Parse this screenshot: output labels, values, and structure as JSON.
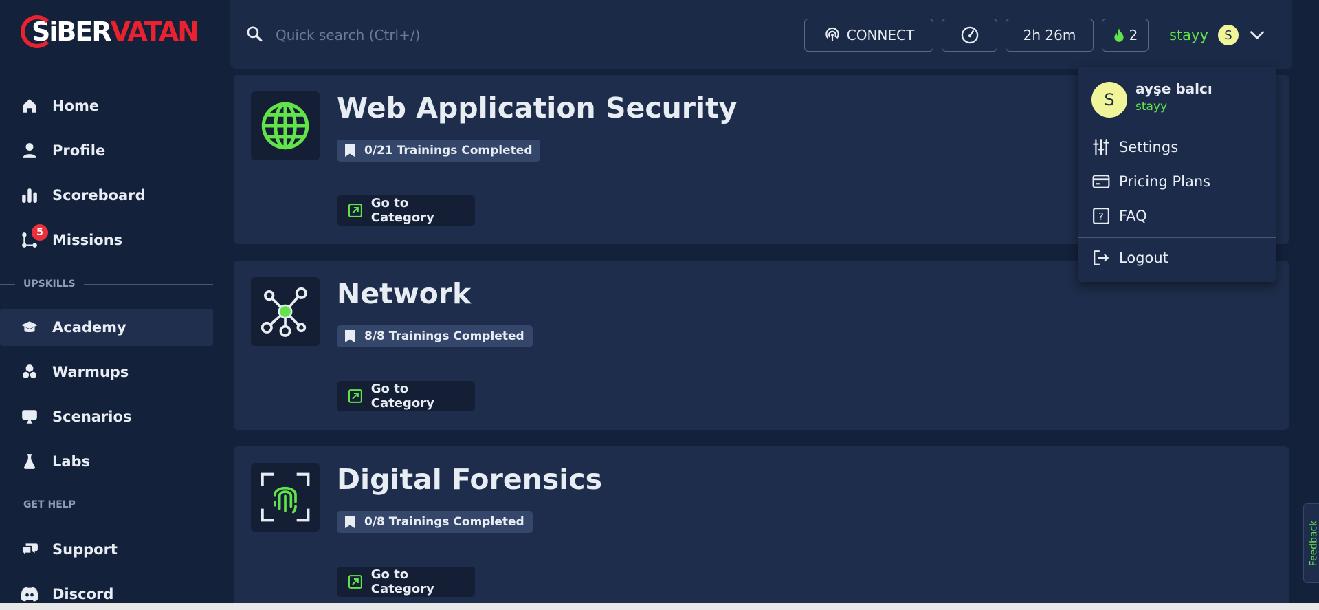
{
  "brand": {
    "logo_left": "Si",
    "logo_mid": "BER",
    "logo_right": "VATAN"
  },
  "sidebar": {
    "items": [
      {
        "label": "Home",
        "icon": "home-icon"
      },
      {
        "label": "Profile",
        "icon": "user-icon"
      },
      {
        "label": "Scoreboard",
        "icon": "bar-chart-icon"
      },
      {
        "label": "Missions",
        "icon": "missions-icon",
        "badge": "5"
      }
    ],
    "section_upskills": "UPSKILLS",
    "upskills": [
      {
        "label": "Academy",
        "icon": "graduation-cap-icon",
        "active": true
      },
      {
        "label": "Warmups",
        "icon": "warmups-icon"
      },
      {
        "label": "Scenarios",
        "icon": "scenarios-icon"
      },
      {
        "label": "Labs",
        "icon": "flask-icon"
      }
    ],
    "section_help": "GET HELP",
    "help": [
      {
        "label": "Support",
        "icon": "chat-bubbles-icon"
      },
      {
        "label": "Discord",
        "icon": "discord-icon"
      }
    ]
  },
  "topbar": {
    "search_placeholder": "Quick search (Ctrl+/)",
    "connect_label": "CONNECT",
    "timer": "2h 26m",
    "streak_count": "2",
    "username": "stayy",
    "avatar_letter": "S"
  },
  "categories": [
    {
      "title": "Web Application Security",
      "progress": "0/21 Trainings Completed",
      "button": "Go to Category",
      "icon": "globe-icon"
    },
    {
      "title": "Network",
      "progress": "8/8 Trainings Completed",
      "button": "Go to Category",
      "icon": "network-icon"
    },
    {
      "title": "Digital Forensics",
      "progress": "0/8 Trainings Completed",
      "button": "Go to Category",
      "icon": "fingerprint-icon"
    }
  ],
  "user_menu": {
    "avatar_letter": "S",
    "full_name": "ayşe balcı",
    "username": "stayy",
    "settings": "Settings",
    "pricing": "Pricing Plans",
    "faq": "FAQ",
    "logout": "Logout"
  },
  "feedback_label": "Feedback",
  "colors": {
    "accent": "#62e34a",
    "background": "#14213a",
    "card": "#1e2d4b",
    "brand_red": "#e8222f",
    "badge_red": "#e8313b"
  }
}
